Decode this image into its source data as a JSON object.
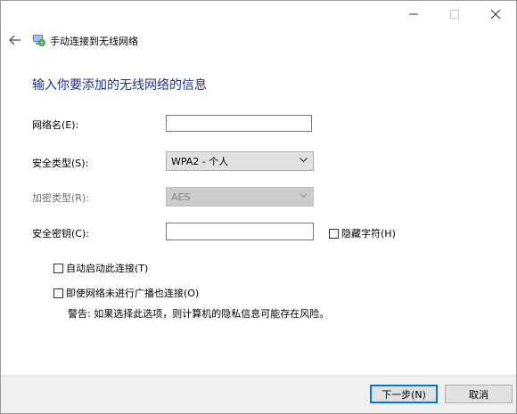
{
  "window": {
    "caption_icons": [
      "minimize-icon",
      "maximize-icon",
      "close-icon"
    ]
  },
  "header": {
    "back_icon": "back-arrow-icon",
    "wizard_icon": "network-globe-icon",
    "title": "手动连接到无线网络"
  },
  "main": {
    "heading": "输入你要添加的无线网络的信息",
    "fields": {
      "network_name_label": "网络名(E):",
      "network_name_value": "",
      "security_type_label": "安全类型(S):",
      "security_type_value": "WPA2 - 个人",
      "encryption_type_label": "加密类型(R):",
      "encryption_type_value": "AES",
      "security_key_label": "安全密钥(C):",
      "security_key_value": ""
    },
    "hide_chars_label": "隐藏字符(H)",
    "auto_start_label": "自动启动此连接(T)",
    "connect_hidden_label": "即使网络未进行广播也连接(O)",
    "warning": "警告: 如果选择此选项，则计算机的隐私信息可能存在风险。"
  },
  "footer": {
    "next_label": "下一步(N)",
    "cancel_label": "取消"
  },
  "colors": {
    "heading": "#1e3287",
    "accent": "#0078d7",
    "footer_bg": "#f0f0f0"
  }
}
